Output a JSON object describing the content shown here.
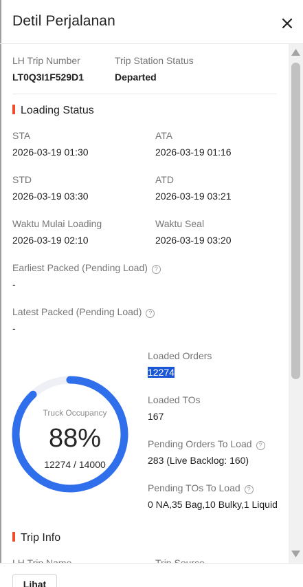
{
  "header": {
    "title": "Detil Perjalanan",
    "close_icon": "close-icon"
  },
  "trip": {
    "lh_trip_number_label": "LH Trip Number",
    "lh_trip_number": "LT0Q3I1F529D1",
    "station_status_label": "Trip Station Status",
    "station_status": "Departed"
  },
  "loading_status": {
    "title": "Loading Status",
    "sta_label": "STA",
    "sta": "2026-03-19 01:30",
    "ata_label": "ATA",
    "ata": "2026-03-19 01:16",
    "std_label": "STD",
    "std": "2026-03-19 03:30",
    "atd_label": "ATD",
    "atd": "2026-03-19 03:21",
    "loading_start_label": "Waktu Mulai Loading",
    "loading_start": "2026-03-19 02:10",
    "seal_label": "Waktu Seal",
    "seal": "2026-03-19 03:20",
    "earliest_packed_label": "Earliest Packed (Pending Load)",
    "earliest_packed": "-",
    "latest_packed_label": "Latest Packed (Pending Load)",
    "latest_packed": "-",
    "help_icon": "question-circle-icon"
  },
  "occupancy": {
    "label": "Truck Occupancy",
    "percent_text": "88%",
    "fraction": 0.88,
    "count_text": "12274 / 14000",
    "track_color": "#eef0f5",
    "fill_color": "#2f6fec"
  },
  "stats": {
    "loaded_orders_label": "Loaded Orders",
    "loaded_orders": "12274",
    "loaded_tos_label": "Loaded TOs",
    "loaded_tos": "167",
    "pending_orders_label": "Pending Orders To Load",
    "pending_orders": "283 (Live Backlog: 160)",
    "pending_tos_label": "Pending TOs To Load",
    "pending_tos": "0 NA,35 Bag,10 Bulky,1 Liquid"
  },
  "trip_info": {
    "title": "Trip Info",
    "lh_trip_name_label": "LH Trip Name",
    "trip_source_label": "Trip Source"
  },
  "footer": {
    "view_button": "Lihat"
  },
  "colors": {
    "accent": "#ee4d2d",
    "selection": "#1a56d6"
  }
}
